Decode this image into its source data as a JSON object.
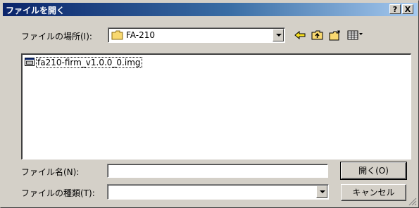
{
  "window": {
    "title": "ファイルを開く",
    "help_label": "?",
    "close_label": "X"
  },
  "location": {
    "label": "ファイルの場所(I):",
    "value": "FA-210"
  },
  "toolbar": {
    "icons": [
      "back-arrow-icon",
      "up-folder-icon",
      "new-folder-icon",
      "view-menu-icon"
    ]
  },
  "files": [
    {
      "name": "fa210-firm_v1.0.0_0.img",
      "icon": "image-file-icon"
    }
  ],
  "filename": {
    "label": "ファイル名(N):",
    "value": ""
  },
  "filetype": {
    "label": "ファイルの種類(T):",
    "value": ""
  },
  "buttons": {
    "open_label": "開く(O)",
    "cancel_label": "キャンセル"
  },
  "colors": {
    "dialog_face": "#d4d0c8",
    "title_start": "#0a246a",
    "title_end": "#a6caf0"
  }
}
